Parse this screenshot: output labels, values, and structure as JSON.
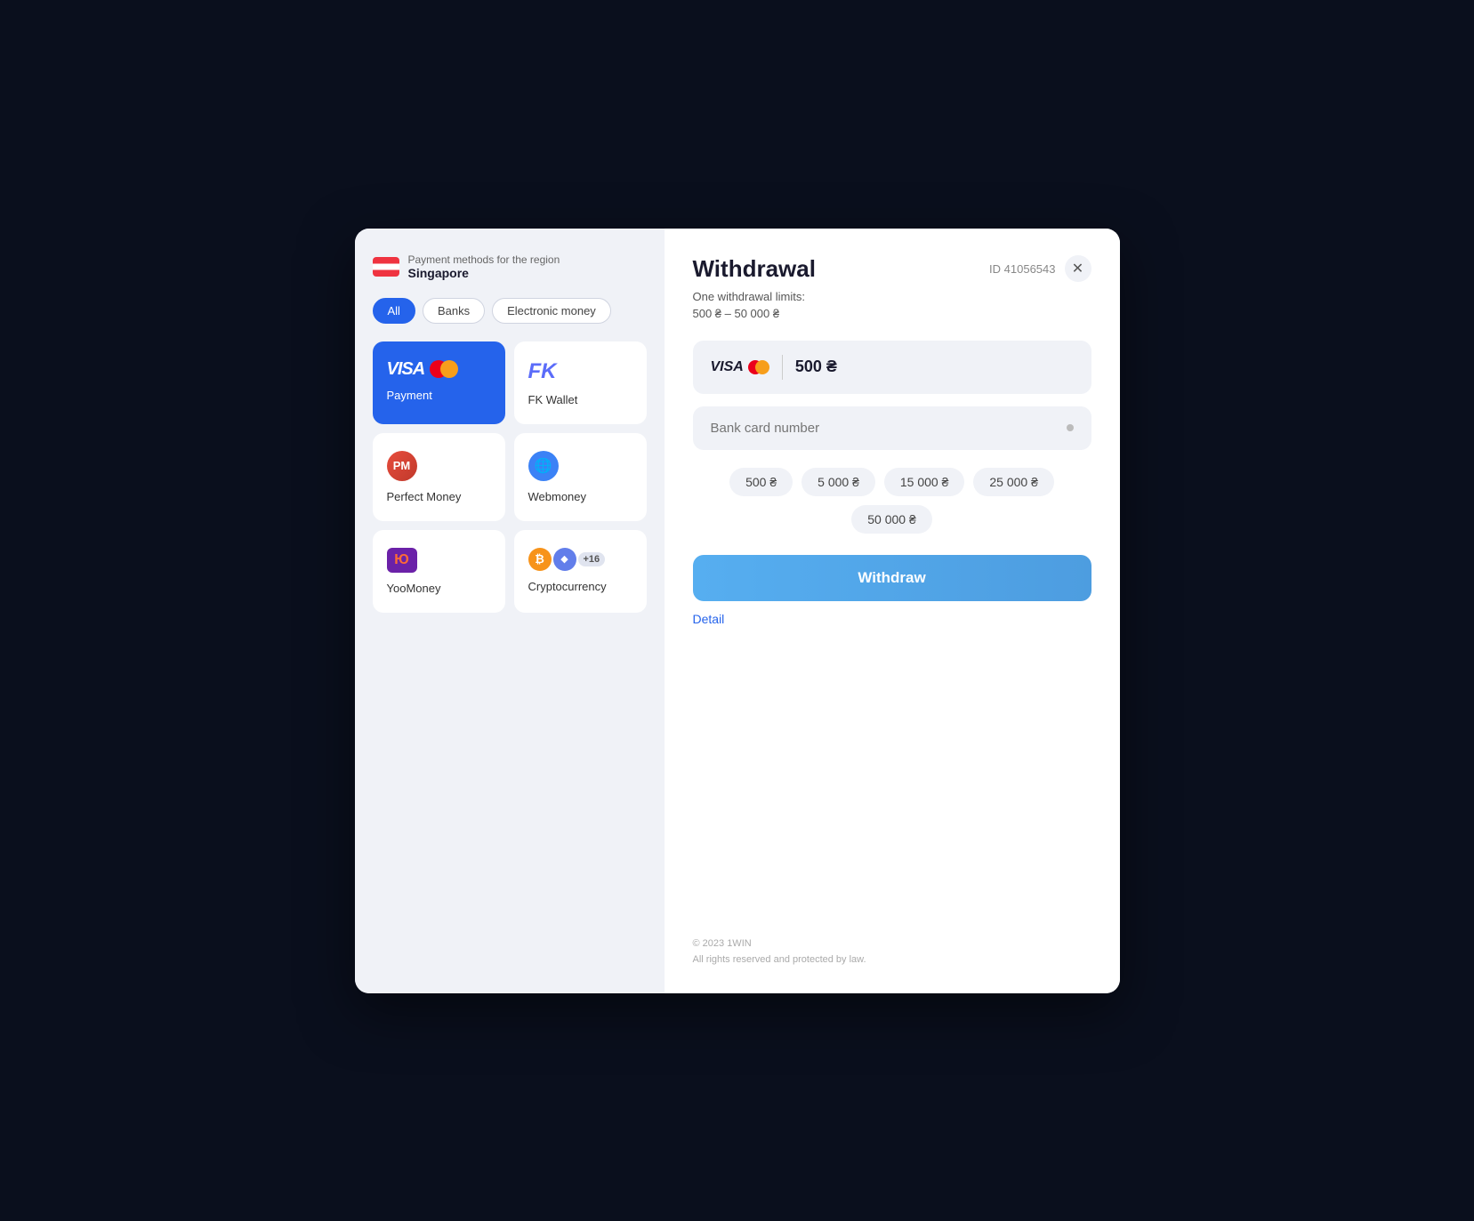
{
  "modal": {
    "left": {
      "region_label": "Payment methods for the region",
      "region_name": "Singapore",
      "filters": [
        {
          "label": "All",
          "active": true
        },
        {
          "label": "Banks",
          "active": false
        },
        {
          "label": "Electronic money",
          "active": false
        }
      ],
      "payment_methods": [
        {
          "id": "visa",
          "label": "Payment",
          "selected": true
        },
        {
          "id": "fkwallet",
          "label": "FK Wallet",
          "selected": false
        },
        {
          "id": "perfectmoney",
          "label": "Perfect Money",
          "selected": false
        },
        {
          "id": "webmoney",
          "label": "Webmoney",
          "selected": false
        },
        {
          "id": "yoomoney",
          "label": "YooMoney",
          "selected": false
        },
        {
          "id": "crypto",
          "label": "Cryptocurrency",
          "selected": false,
          "plus_count": "+16"
        }
      ]
    },
    "right": {
      "title": "Withdrawal",
      "id_label": "ID 41056543",
      "limits_line1": "One withdrawal limits:",
      "limits_line2": "500 ₴ – 50 000 ₴",
      "selected_method_logo": "VISA",
      "amount_value": "500 ₴",
      "bank_card_placeholder": "Bank card number",
      "quick_amounts": [
        "500 ₴",
        "5 000 ₴",
        "15 000 ₴",
        "25 000 ₴",
        "50 000 ₴"
      ],
      "withdraw_button_label": "Withdraw",
      "detail_link_label": "Detail",
      "footer_copyright": "© 2023 1WIN",
      "footer_rights": "All rights reserved and protected by law."
    }
  }
}
